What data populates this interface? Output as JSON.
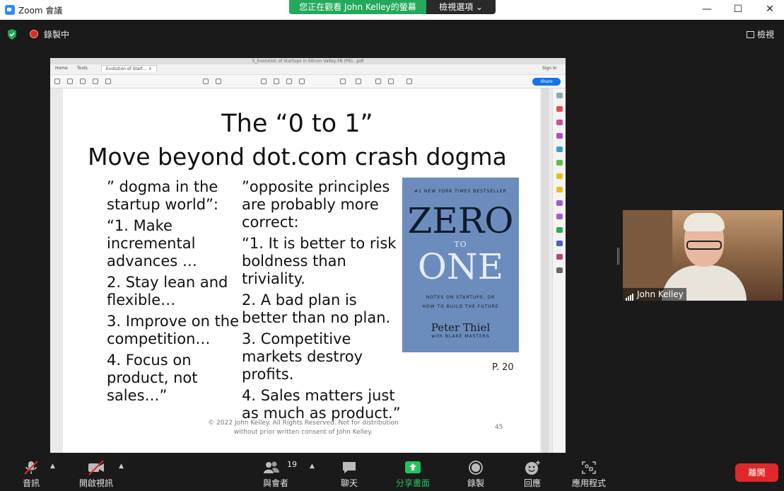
{
  "window": {
    "title": "Zoom 會議",
    "minimize": "—",
    "maximize": "☐",
    "close": "✕"
  },
  "share_banner": {
    "viewing_text": "您正在觀看 John  Kelley的螢幕",
    "view_options": "檢視選項 ⌄"
  },
  "status": {
    "recording": "錄製中",
    "view": "檢視"
  },
  "acrobat": {
    "title": "5_Evolution of Startups in Silicon Valley-FB (P6)...pdf",
    "tabs": [
      "Home",
      "Tools",
      "Evolution of Start..."
    ],
    "tab_close": "×",
    "sign_in": "Sign In",
    "share": "Share"
  },
  "slide": {
    "title_line1": "The “0 to 1”",
    "title_line2": "Move beyond dot.com crash dogma",
    "col1": [
      "” dogma in the startup world”:",
      "“1. Make incremental advances …",
      "2. Stay lean and flexible…",
      "3. Improve on the competition…",
      "4. Focus on product, not sales…”"
    ],
    "col2": [
      "”opposite principles are probably more correct:",
      "“1. It is better to risk boldness than triviality.",
      "2. A bad plan is better than no plan.",
      "3. Competitive markets destroy profits.",
      "4. Sales matters just as much as product.”"
    ],
    "book": {
      "bestseller": "#1 NEW YORK TIMES BESTSELLER",
      "word1": "ZERO",
      "word2": "TO",
      "word3": "ONE",
      "subtitle1": "NOTES ON STARTUPS, OR",
      "subtitle2": "HOW TO BUILD THE FUTURE",
      "author": "Peter Thiel",
      "coauthor": "with BLAKE MASTERS"
    },
    "page_ref": "P. 20",
    "copyright_line1": "© 2022 John Kelley. All Rights Reserved. Not for distribution",
    "copyright_line2": "without prior written consent of John Kelley.",
    "slide_number": "45"
  },
  "participant": {
    "name": "John Kelley"
  },
  "toolbar": {
    "audio": "音訊",
    "video": "開啟視訊",
    "participants": "與會者",
    "participants_count": "19",
    "chat": "聊天",
    "share": "分享畫面",
    "record": "錄製",
    "reactions": "回應",
    "apps": "應用程式",
    "leave": "離開"
  },
  "colors": {
    "zoom_blue": "#2d8cff",
    "share_green": "#22a95a",
    "leave_red": "#e02828",
    "book_blue": "#6b8cbd"
  }
}
